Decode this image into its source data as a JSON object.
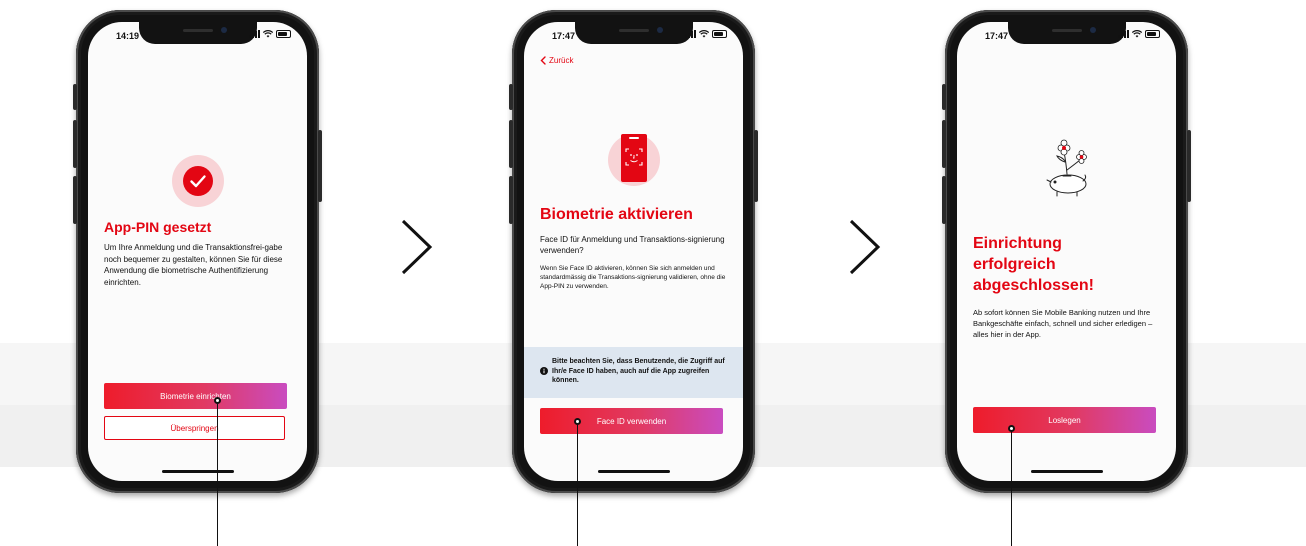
{
  "colors": {
    "brand_red": "#e30613",
    "gradient_end": "#c94cc0",
    "info_bg": "#dde6f0"
  },
  "flow_arrows": [
    "chevron-right-icon",
    "chevron-right-icon"
  ],
  "screens": [
    {
      "time": "14:19",
      "icon": "checkmark-circle-icon",
      "title": "App-PIN gesetzt",
      "body": "Um Ihre Anmeldung und die Transaktionsfrei-gabe noch bequemer zu gestalten, können Sie für diese Anwendung die biometrische Authentifizierung einrichten.",
      "primary_button": "Biometrie einrichten",
      "secondary_button": "Überspringen"
    },
    {
      "time": "17:47",
      "back_label": "Zurück",
      "icon": "face-id-icon",
      "title": "Biometrie aktivieren",
      "question": "Face ID für Anmeldung und Transaktions-signierung verwenden?",
      "body": "Wenn Sie Face ID aktivieren, können Sie sich anmelden und standardmässig die Transaktions-signierung validieren, ohne die App-PIN zu verwenden.",
      "info": "Bitte beachten Sie, dass Benutzende, die Zugriff auf Ihr/e Face ID haben, auch auf die App zugreifen können.",
      "primary_button": "Face ID verwenden"
    },
    {
      "time": "17:47",
      "icon": "piggy-bank-flower-illustration",
      "title": "Einrichtung erfolgreich abgeschlossen!",
      "body": "Ab sofort können Sie Mobile Banking nutzen und Ihre Bankgeschäfte einfach, schnell und sicher erledigen – alles hier in der App.",
      "primary_button": "Loslegen"
    }
  ]
}
